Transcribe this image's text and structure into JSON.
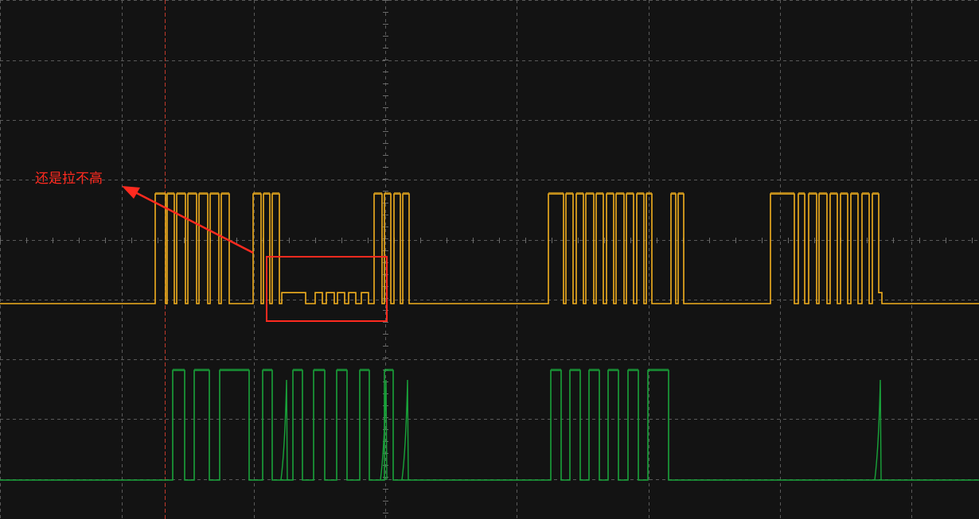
{
  "chart_data": {
    "type": "line",
    "grid": true,
    "colors": {
      "background": "#131313",
      "grid": "#5a5a5a",
      "trigger_marker": "#c0392b",
      "annotation": "#ff2a1f"
    },
    "series": [
      {
        "color": "#f2b01e",
        "levels": {
          "low": 0,
          "high": 1,
          "mid": 0.1
        },
        "edges": [
          [
            0,
            0
          ],
          [
            195,
            1
          ],
          [
            208,
            0
          ],
          [
            210,
            1
          ],
          [
            219,
            0
          ],
          [
            222,
            1
          ],
          [
            233,
            0
          ],
          [
            236,
            1
          ],
          [
            247,
            0
          ],
          [
            250,
            1
          ],
          [
            261,
            0
          ],
          [
            264,
            1
          ],
          [
            275,
            0
          ],
          [
            278,
            1
          ],
          [
            288,
            0
          ],
          [
            318,
            1
          ],
          [
            328,
            0
          ],
          [
            331,
            1
          ],
          [
            339,
            0
          ],
          [
            342,
            1
          ],
          [
            351,
            0
          ],
          [
            354,
            0.1
          ],
          [
            366,
            0.1
          ],
          [
            384,
            0
          ],
          [
            396,
            0.1
          ],
          [
            405,
            0
          ],
          [
            410,
            0.1
          ],
          [
            420,
            0
          ],
          [
            424,
            0.1
          ],
          [
            433,
            0
          ],
          [
            438,
            0.1
          ],
          [
            447,
            0
          ],
          [
            454,
            0.1
          ],
          [
            463,
            0
          ],
          [
            470,
            1
          ],
          [
            480,
            0
          ],
          [
            483,
            1
          ],
          [
            491,
            0
          ],
          [
            495,
            1
          ],
          [
            503,
            0
          ],
          [
            506,
            1
          ],
          [
            514,
            0
          ],
          [
            689,
            1
          ],
          [
            708,
            0
          ],
          [
            711,
            1
          ],
          [
            720,
            0
          ],
          [
            724,
            1
          ],
          [
            733,
            0
          ],
          [
            736,
            1
          ],
          [
            746,
            0
          ],
          [
            749,
            1
          ],
          [
            758,
            0
          ],
          [
            762,
            1
          ],
          [
            771,
            0
          ],
          [
            774,
            1
          ],
          [
            784,
            0
          ],
          [
            787,
            1
          ],
          [
            796,
            0
          ],
          [
            800,
            1
          ],
          [
            809,
            0
          ],
          [
            812,
            1
          ],
          [
            819,
            0
          ],
          [
            843,
            1
          ],
          [
            849,
            0
          ],
          [
            852,
            1
          ],
          [
            859,
            0
          ],
          [
            968,
            1
          ],
          [
            998,
            0
          ],
          [
            1003,
            1
          ],
          [
            1011,
            0
          ],
          [
            1016,
            1
          ],
          [
            1026,
            0
          ],
          [
            1029,
            1
          ],
          [
            1039,
            0
          ],
          [
            1043,
            1
          ],
          [
            1052,
            0
          ],
          [
            1056,
            1
          ],
          [
            1065,
            0
          ],
          [
            1069,
            1
          ],
          [
            1078,
            0
          ],
          [
            1083,
            1
          ],
          [
            1092,
            0
          ],
          [
            1096,
            1
          ],
          [
            1104,
            0.1
          ],
          [
            1108,
            0
          ],
          [
            1230,
            0
          ]
        ]
      },
      {
        "color": "#19a33a",
        "levels": {
          "low": 0,
          "high": 1
        },
        "edges": [
          [
            0,
            0
          ],
          [
            217,
            1
          ],
          [
            232,
            0
          ],
          [
            244,
            1
          ],
          [
            263,
            0
          ],
          [
            276,
            1
          ],
          [
            313,
            0
          ],
          [
            330,
            1
          ],
          [
            342,
            0
          ],
          [
            368,
            1
          ],
          [
            380,
            0
          ],
          [
            394,
            1
          ],
          [
            408,
            0
          ],
          [
            423,
            1
          ],
          [
            436,
            0
          ],
          [
            452,
            1
          ],
          [
            464,
            0
          ],
          [
            483,
            1
          ],
          [
            494,
            0
          ],
          [
            692,
            1
          ],
          [
            705,
            0
          ],
          [
            716,
            1
          ],
          [
            729,
            0
          ],
          [
            740,
            1
          ],
          [
            753,
            0
          ],
          [
            764,
            1
          ],
          [
            777,
            0
          ],
          [
            789,
            1
          ],
          [
            802,
            0
          ],
          [
            814,
            1
          ],
          [
            840,
            0
          ],
          [
            1230,
            0
          ]
        ],
        "spikes": [
          360,
          485,
          512,
          1106
        ]
      }
    ]
  },
  "annotation": {
    "text": "还是拉不高"
  }
}
